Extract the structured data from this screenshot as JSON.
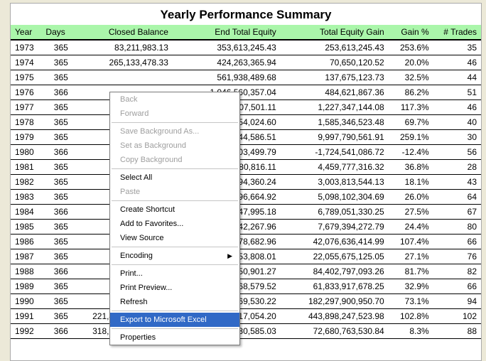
{
  "title": "Yearly Performance Summary",
  "columns": [
    "Year",
    "Days",
    "Closed Balance",
    "End Total Equity",
    "Total Equity Gain",
    "Gain %",
    "# Trades"
  ],
  "rows": [
    {
      "year": "1973",
      "days": "365",
      "closed": "83,211,983.13",
      "end": "353,613,245.43",
      "gain": "253,613,245.43",
      "pct": "253.6%",
      "tr": "35"
    },
    {
      "year": "1974",
      "days": "365",
      "closed": "265,133,478.33",
      "end": "424,263,365.94",
      "gain": "70,650,120.52",
      "pct": "20.0%",
      "tr": "46"
    },
    {
      "year": "1975",
      "days": "365",
      "closed": "",
      "end": "561,938,489.68",
      "gain": "137,675,123.73",
      "pct": "32.5%",
      "tr": "44"
    },
    {
      "year": "1976",
      "days": "366",
      "closed": "",
      "end": "1,046,560,357.04",
      "gain": "484,621,867.36",
      "pct": "86.2%",
      "tr": "51"
    },
    {
      "year": "1977",
      "days": "365",
      "closed": "",
      "end": "2,273,907,501.11",
      "gain": "1,227,347,144.08",
      "pct": "117.3%",
      "tr": "46"
    },
    {
      "year": "1978",
      "days": "365",
      "closed": "",
      "end": "3,859,254,024.60",
      "gain": "1,585,346,523.48",
      "pct": "69.7%",
      "tr": "40"
    },
    {
      "year": "1979",
      "days": "365",
      "closed": "",
      "end": "13,857,044,586.51",
      "gain": "9,997,790,561.91",
      "pct": "259.1%",
      "tr": "30"
    },
    {
      "year": "1980",
      "days": "366",
      "closed": "",
      "end": "12,132,503,499.79",
      "gain": "-1,724,541,086.72",
      "pct": "-12.4%",
      "tr": "56"
    },
    {
      "year": "1981",
      "days": "365",
      "closed": "",
      "end": "16,592,280,816.11",
      "gain": "4,459,777,316.32",
      "pct": "36.8%",
      "tr": "28"
    },
    {
      "year": "1982",
      "days": "365",
      "closed": "",
      "end": "19,596,094,360.24",
      "gain": "3,003,813,544.13",
      "pct": "18.1%",
      "tr": "43"
    },
    {
      "year": "1983",
      "days": "365",
      "closed": "",
      "end": "24,694,196,664.92",
      "gain": "5,098,102,304.69",
      "pct": "26.0%",
      "tr": "64"
    },
    {
      "year": "1984",
      "days": "366",
      "closed": "",
      "end": "31,483,247,995.18",
      "gain": "6,789,051,330.25",
      "pct": "27.5%",
      "tr": "67"
    },
    {
      "year": "1985",
      "days": "365",
      "closed": "",
      "end": "39,162,642,267.96",
      "gain": "7,679,394,272.79",
      "pct": "24.4%",
      "tr": "80"
    },
    {
      "year": "1986",
      "days": "365",
      "closed": "",
      "end": "81,239,278,682.96",
      "gain": "42,076,636,414.99",
      "pct": "107.4%",
      "tr": "66"
    },
    {
      "year": "1987",
      "days": "365",
      "closed": "",
      "end": "103,294,953,808.01",
      "gain": "22,055,675,125.05",
      "pct": "27.1%",
      "tr": "76"
    },
    {
      "year": "1988",
      "days": "366",
      "closed": "",
      "end": "187,697,750,901.27",
      "gain": "84,402,797,093.26",
      "pct": "81.7%",
      "tr": "82"
    },
    {
      "year": "1989",
      "days": "365",
      "closed": "",
      "end": "249,531,668,579.52",
      "gain": "61,833,917,678.25",
      "pct": "32.9%",
      "tr": "66"
    },
    {
      "year": "1990",
      "days": "365",
      "closed": "",
      "end": "431,829,569,530.22",
      "gain": "182,297,900,950.70",
      "pct": "73.1%",
      "tr": "94"
    },
    {
      "year": "1991",
      "days": "365",
      "closed": "221,432,712,056.19",
      "end": "875,727,817,054.20",
      "gain": "443,898,247,523.98",
      "pct": "102.8%",
      "tr": "102"
    },
    {
      "year": "1992",
      "days": "366",
      "closed": "318,542,618,146.92",
      "end": "948,408,580,585.03",
      "gain": "72,680,763,530.84",
      "pct": "8.3%",
      "tr": "88"
    }
  ],
  "menu": {
    "back": "Back",
    "forward": "Forward",
    "savebg": "Save Background As...",
    "setbg": "Set as Background",
    "copybg": "Copy Background",
    "selall": "Select All",
    "paste": "Paste",
    "shortcut": "Create Shortcut",
    "fav": "Add to Favorites...",
    "source": "View Source",
    "encoding": "Encoding",
    "print": "Print...",
    "preview": "Print Preview...",
    "refresh": "Refresh",
    "export": "Export to Microsoft Excel",
    "props": "Properties"
  }
}
